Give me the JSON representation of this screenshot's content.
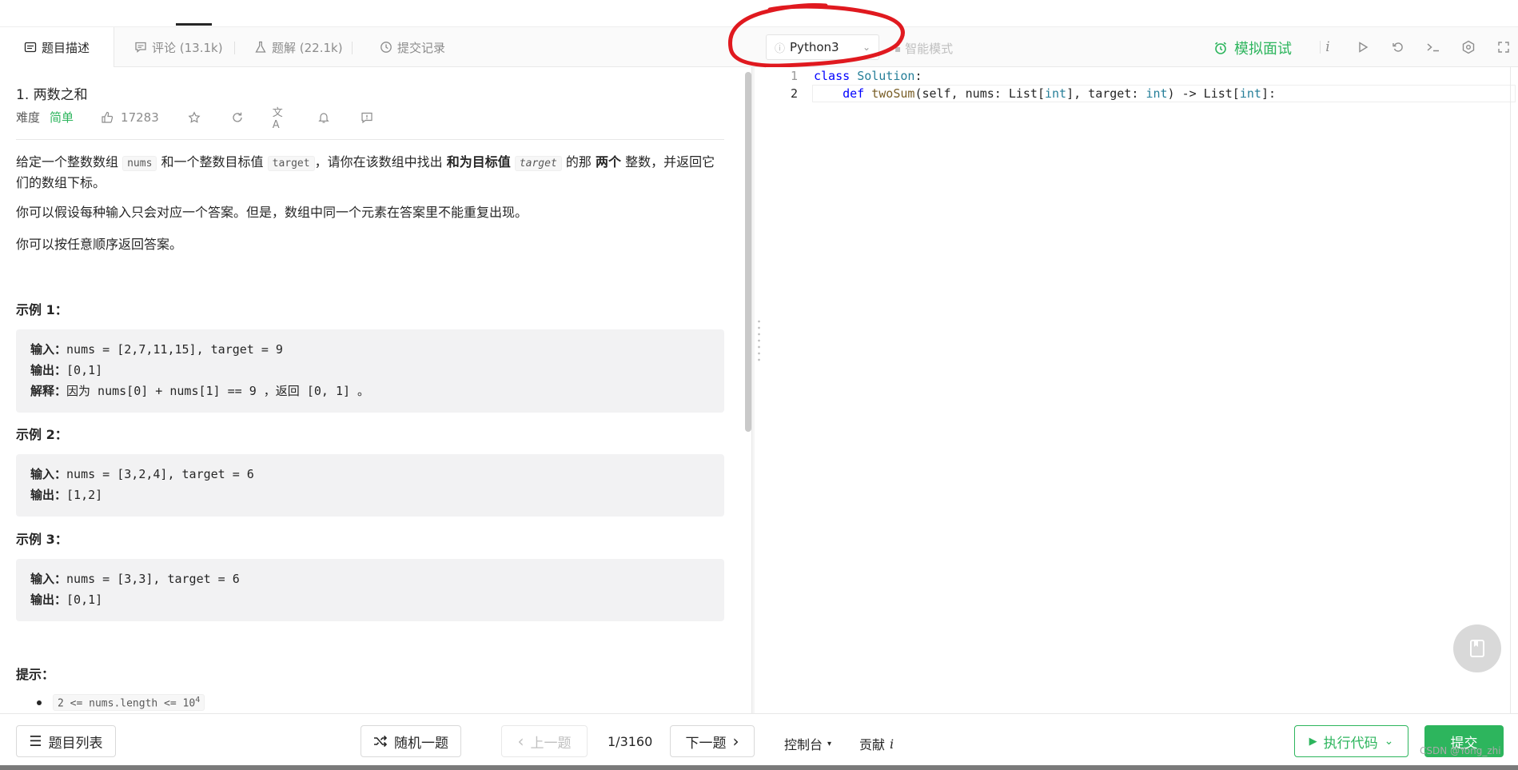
{
  "tabs": [
    {
      "label": "题目描述",
      "icon": "description-icon"
    },
    {
      "label": "评论 (13.1k)",
      "icon": "comment-icon"
    },
    {
      "label": "题解 (22.1k)",
      "icon": "flask-icon"
    },
    {
      "label": "提交记录",
      "icon": "clock-icon"
    }
  ],
  "editor_toolbar": {
    "language": "Python3",
    "smart_mode": "智能模式",
    "mock_interview": "模拟面试"
  },
  "problem": {
    "title": "1. 两数之和",
    "difficulty_label": "难度",
    "difficulty": "简单",
    "likes": "17283",
    "desc_1_a": "给定一个整数数组",
    "desc_1_code1": "nums",
    "desc_1_b": "和一个整数目标值",
    "desc_1_code2": "target",
    "desc_1_c": "，请你在该数组中找出",
    "desc_1_bold1": "和为目标值",
    "desc_1_code3": "target",
    "desc_1_d": "的那",
    "desc_1_bold2": "两个",
    "desc_1_e": "整数，并返回它们的数组下标。",
    "desc_2": "你可以假设每种输入只会对应一个答案。但是，数组中同一个元素在答案里不能重复出现。",
    "desc_3": "你可以按任意顺序返回答案。",
    "examples": [
      {
        "title": "示例 1：",
        "in_label": "输入：",
        "input": "nums = [2,7,11,15], target = 9",
        "out_label": "输出：",
        "output": "[0,1]",
        "exp_label": "解释：",
        "exp_a": "因为",
        "exp_code": " nums[0] + nums[1] == 9 ",
        "exp_b": "，返回",
        "exp_code2": " [0, 1] ",
        "exp_c": "。"
      },
      {
        "title": "示例 2：",
        "in_label": "输入：",
        "input": "nums = [3,2,4], target = 6",
        "out_label": "输出：",
        "output": "[1,2]"
      },
      {
        "title": "示例 3：",
        "in_label": "输入：",
        "input": "nums = [3,3], target = 6",
        "out_label": "输出：",
        "output": "[0,1]"
      }
    ],
    "hint_title": "提示：",
    "constraint_base": "2 <= nums.length <= 10",
    "constraint_exp": "4"
  },
  "code": {
    "line_numbers": [
      "1",
      "2"
    ],
    "line1_kw": "class",
    "line1_name": "Solution",
    "line1_rest": ":",
    "line2_kw": "def",
    "line2_fn": "twoSum",
    "line2_a": "(self, nums: List[",
    "line2_t1": "int",
    "line2_b": "], target: ",
    "line2_t2": "int",
    "line2_c": ") -> List[",
    "line2_t3": "int",
    "line2_d": "]:"
  },
  "bottom": {
    "problem_list": "题目列表",
    "random": "随机一题",
    "prev": "上一题",
    "page": "1/3160",
    "next": "下一题",
    "console": "控制台",
    "contribute": "贡献",
    "run": "执行代码",
    "submit": "提交"
  },
  "watermark": "CSDN @Yong_zhi",
  "colors": {
    "accent": "#2db55d",
    "annotation": "#e0191f"
  }
}
